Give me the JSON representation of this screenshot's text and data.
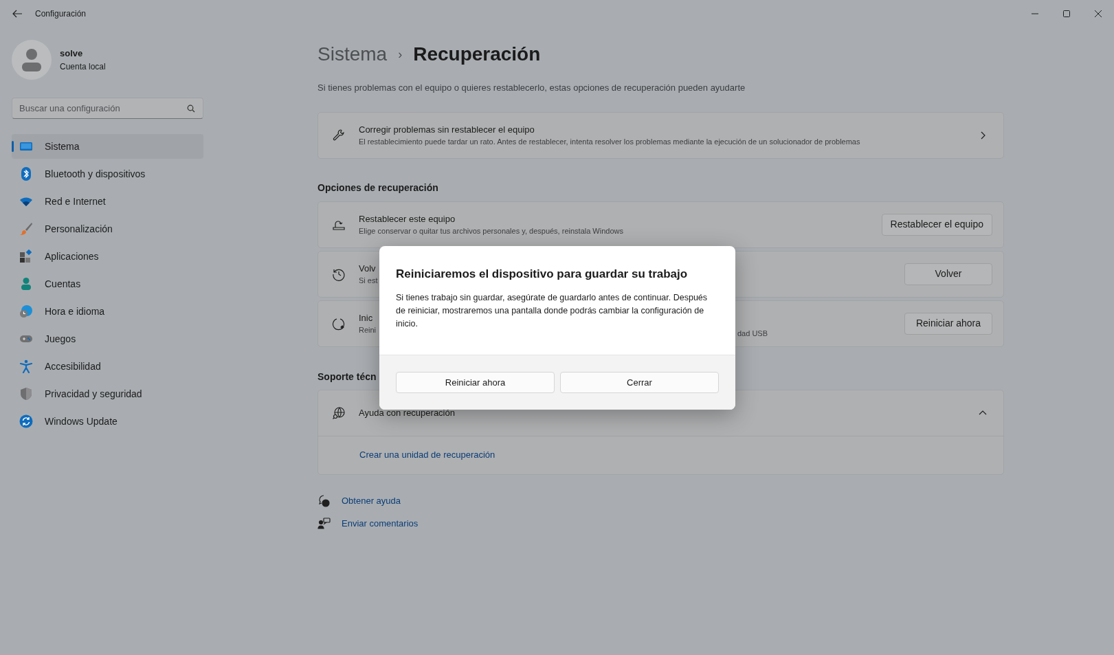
{
  "window": {
    "title": "Configuración"
  },
  "user": {
    "name": "solve",
    "account": "Cuenta local"
  },
  "search": {
    "placeholder": "Buscar una configuración"
  },
  "sidebar": {
    "items": [
      {
        "label": "Sistema",
        "selected": true
      },
      {
        "label": "Bluetooth y dispositivos",
        "selected": false
      },
      {
        "label": "Red e Internet",
        "selected": false
      },
      {
        "label": "Personalización",
        "selected": false
      },
      {
        "label": "Aplicaciones",
        "selected": false
      },
      {
        "label": "Cuentas",
        "selected": false
      },
      {
        "label": "Hora e idioma",
        "selected": false
      },
      {
        "label": "Juegos",
        "selected": false
      },
      {
        "label": "Accesibilidad",
        "selected": false
      },
      {
        "label": "Privacidad y seguridad",
        "selected": false
      },
      {
        "label": "Windows Update",
        "selected": false
      }
    ]
  },
  "breadcrumb": {
    "parent": "Sistema",
    "separator": "›",
    "current": "Recuperación"
  },
  "description": "Si tienes problemas con el equipo o quieres restablecerlo, estas opciones de recuperación pueden ayudarte",
  "fix_card": {
    "title": "Corregir problemas sin restablecer el equipo",
    "subtitle": "El restablecimiento puede tardar un rato. Antes de restablecer, intenta resolver los problemas mediante la ejecución de un solucionador de problemas"
  },
  "recovery_section": {
    "heading": "Opciones de recuperación",
    "rows": [
      {
        "title": "Restablecer este equipo",
        "subtitle": "Elige conservar o quitar tus archivos personales y, después, reinstala Windows",
        "button": "Restablecer el equipo"
      },
      {
        "title": "Volv",
        "subtitle": "Si est",
        "button": "Volver"
      },
      {
        "title": "Inic",
        "subtitle": "Reini",
        "subtitle_end": "dad USB",
        "button": "Reiniciar ahora"
      }
    ]
  },
  "support_section": {
    "heading": "Soporte técn",
    "card": {
      "title": "Ayuda con recuperación",
      "expanded": true,
      "link": "Crear una unidad de recuperación"
    }
  },
  "footer_links": [
    {
      "label": "Obtener ayuda"
    },
    {
      "label": "Enviar comentarios"
    }
  ],
  "dialog": {
    "title": "Reiniciaremos el dispositivo para guardar su trabajo",
    "body": "Si tienes trabajo sin guardar, asegúrate de guardarlo antes de continuar. Después de reiniciar, mostraremos una pantalla donde podrás cambiar la configuración de inicio.",
    "buttons": [
      "Reiniciar ahora",
      "Cerrar"
    ]
  }
}
